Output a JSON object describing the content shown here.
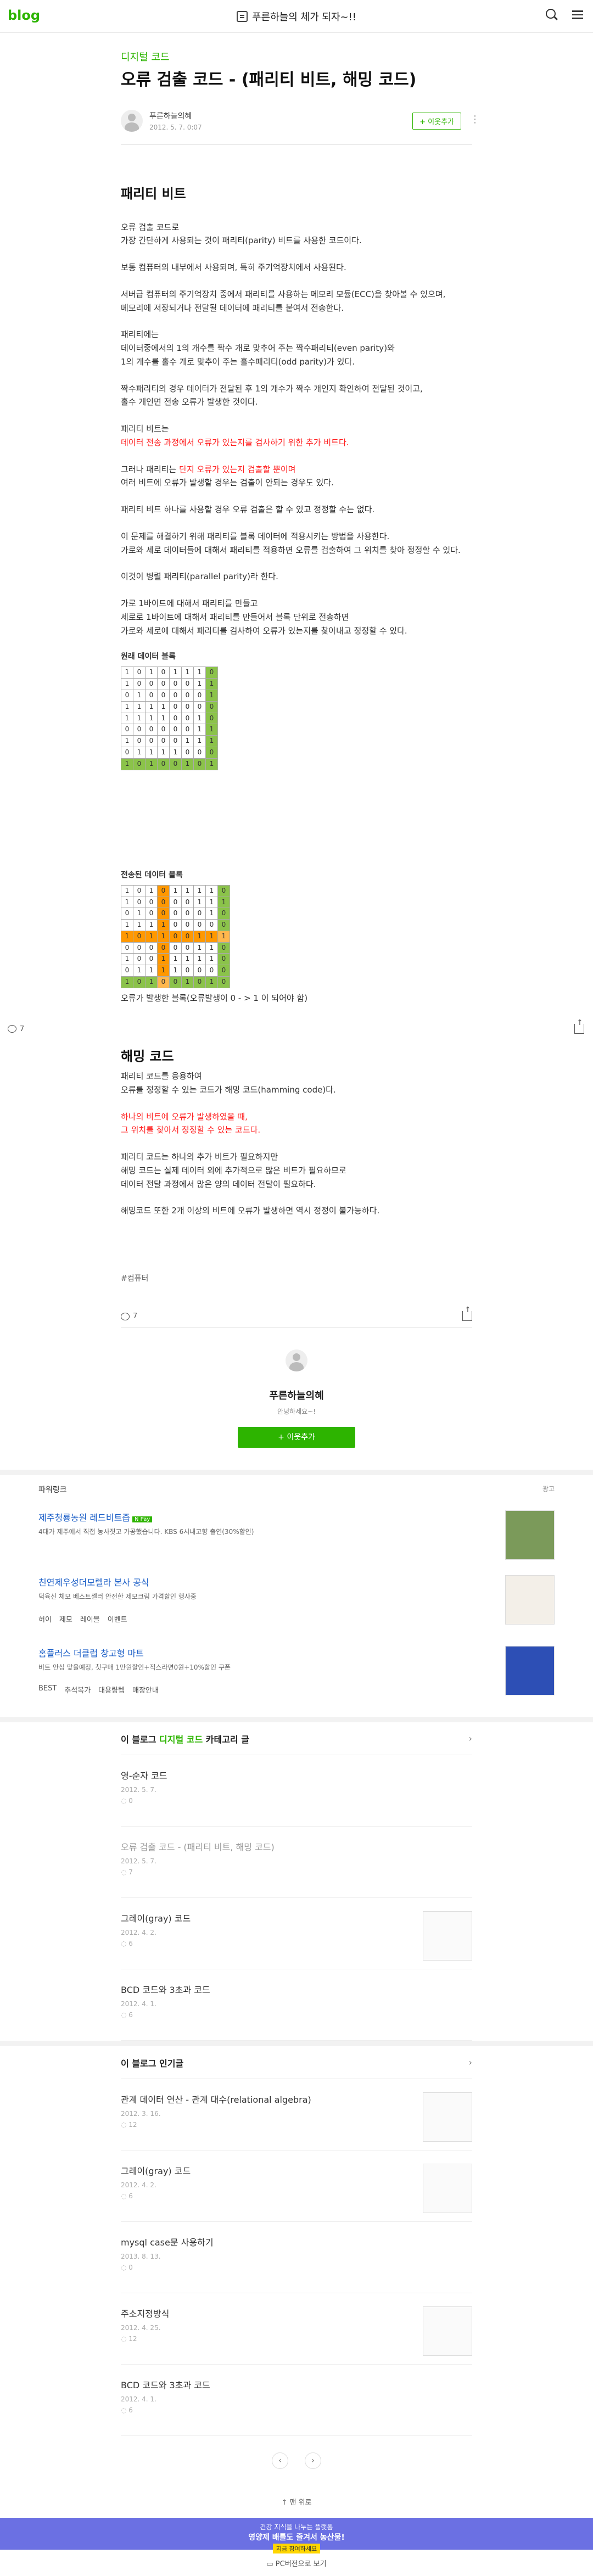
{
  "header": {
    "logo": "blog",
    "blog_title": "푸른하늘의 체가 되자~!!"
  },
  "post": {
    "category": "디지털 코드",
    "title": "오류 검출 코드 - (패리티 비트, 해밍 코드)",
    "author": "푸른하늘의혜",
    "date": "2012. 5. 7. 0:07",
    "follow_label": "+ 이웃추가",
    "section1_title": "패리티 비트",
    "p1": "오류 검출 코드로\n가장 간단하게 사용되는 것이 패리티(parity) 비트를 사용한 코드이다.",
    "p2": "보통 컴퓨터의 내부에서 사용되며, 특히 주기억장치에서 사용된다.",
    "p3": "서버급 컴퓨터의 주기억장치 중에서 패리티를 사용하는 메모리 모듈(ECC)을 찾아볼 수 있으며,\n메모리에 저장되거나 전달될 데이터에 패리티를 붙여서 전송한다.",
    "p4": " 패리티에는\n데이터중에서의 1의 개수를 짝수 개로 맞추어 주는 짝수패리티(even parity)와\n1의 개수를 홀수 개로 맞추어 주는 홀수패리티(odd parity)가 있다.",
    "p5": "짝수패리티의 경우 데이터가 전달된 후 1의 개수가 짝수 개인지 확인하여 전달된 것이고,\n홀수 개인면 전송 오류가 발생한 것이다.",
    "p6a": "패리티 비트는",
    "p6b": "데이터 전송 과정에서 오류가 있는지를 검사하기 위한 추가 비트다.",
    "p7a": "그러나 패리티는 ",
    "p7b": "단지 오류가 있는지 검출할 뿐이며",
    "p7c": "여러 비트에 오류가 발생할 경우는 검출이 안되는 경우도 있다.",
    "p8": "패리티 비트 하나를 사용할 경우 오류 검출은 할 수 있고 정정할 수는 없다.",
    "p9": "이 문제를 해결하기 위해 패리티를 블록 데이터에 적용시키는 방법을 사용한다.\n가로와 세로 데이터들에 대해서 패리티를 적용하면 오류를 검출하여 그 위치를 찾아 정정할 수 있다.",
    "p10": "이것이 병렬 패리티(parallel parity)라 한다.",
    "p11": "가로 1바이트에 대해서 패리티를 만들고\n세로로 1바이트에 대해서 패리티를 만들어서 블록 단위로 전송하면\n가로와 세로에 대해서 패리티를 검사하여 오류가 있는지를 찾아내고 정정할 수 있다.",
    "table1_label": "원래 데이터 블록",
    "table1": [
      [
        "1",
        "0",
        "1",
        "0",
        "1",
        "1",
        "1",
        "0"
      ],
      [
        "1",
        "0",
        "0",
        "0",
        "0",
        "0",
        "1",
        "1"
      ],
      [
        "0",
        "1",
        "0",
        "0",
        "0",
        "0",
        "0",
        "1"
      ],
      [
        "1",
        "1",
        "1",
        "1",
        "0",
        "0",
        "0",
        "0"
      ],
      [
        "1",
        "1",
        "1",
        "1",
        "0",
        "0",
        "1",
        "0"
      ],
      [
        "0",
        "0",
        "0",
        "0",
        "0",
        "0",
        "1",
        "1"
      ],
      [
        "1",
        "0",
        "0",
        "0",
        "0",
        "1",
        "1",
        "1"
      ],
      [
        "0",
        "1",
        "1",
        "1",
        "1",
        "0",
        "0",
        "0"
      ],
      [
        "1",
        "0",
        "1",
        "0",
        "0",
        "1",
        "0",
        "1"
      ]
    ],
    "table2_label": "전송된 데이터 블록",
    "table2": [
      [
        "1",
        "0",
        "1",
        "0",
        "1",
        "1",
        "1",
        "1",
        "0"
      ],
      [
        "1",
        "0",
        "0",
        "0",
        "0",
        "0",
        "1",
        "1",
        "1"
      ],
      [
        "0",
        "1",
        "0",
        "0",
        "0",
        "0",
        "0",
        "1",
        "0"
      ],
      [
        "1",
        "1",
        "1",
        "1",
        "0",
        "0",
        "0",
        "0",
        "0"
      ],
      [
        "1",
        "0",
        "1",
        "1",
        "0",
        "0",
        "1",
        "1",
        "1"
      ],
      [
        "0",
        "0",
        "0",
        "0",
        "0",
        "0",
        "1",
        "1",
        "0"
      ],
      [
        "1",
        "0",
        "0",
        "1",
        "1",
        "1",
        "1",
        "1",
        "0"
      ],
      [
        "0",
        "1",
        "1",
        "1",
        "1",
        "0",
        "0",
        "0",
        "0"
      ],
      [
        "1",
        "0",
        "1",
        "0",
        "0",
        "1",
        "0",
        "1",
        "0"
      ]
    ],
    "table_caption": "오류가 발생한 블록(오류발생이 0 - > 1 이 되어야 함)",
    "comment_count": "7",
    "section2_title": "해밍 코드",
    "h1": "패리티 코드를 응용하여\n오류를 정정할 수 있는 코드가 해밍 코드(hamming code)다.",
    "h2": "하나의 비트에 오류가 발생하였을 때,\n그 위치를 찾아서 정정할 수 있는 코드다.",
    "h3": "패리티 코드는 하나의 추가 비트가 필요하지만\n해밍 코드는 실제 데이터 외에 추가적으로 많은 비트가 필요하므로\n데이터 전달 과정에서 많은 양의 데이터 전달이 필요하다.",
    "h4": "해밍코드 또한 2개 이상의 비트에 오류가 발생하면 역시 정정이 불가능하다.",
    "tag": "#컴퓨터"
  },
  "profile": {
    "name": "푸른하늘의혜",
    "desc": "안녕하세요~!",
    "follow": "+ 이웃추가"
  },
  "ads": {
    "label": "파워링크",
    "ad_label": "광고",
    "items": [
      {
        "title": "제주청룡농원 레드비트즙",
        "badge": "N Pay",
        "sub": "4대가 제주에서 직접 농사짓고 가공했습니다. KBS 6시내고향 출연(30%할인)"
      },
      {
        "title": "친연제우성더모렐라 본사 공식",
        "sub": "덕육신 체모 베스트셀러 안전한 제모크림 가격할인 행사중"
      },
      {
        "title": "홈플러스 더클럽 창고형 마트",
        "sub": "비트 안심 맞을예정, 첫구매 1만원할인+적스라면0원+10%할인 쿠폰"
      }
    ],
    "links1": [
      "허이",
      "제모",
      "레이블",
      "이벤트"
    ],
    "links2": [
      "BEST",
      "추석복가",
      "대용량템",
      "매장안내"
    ]
  },
  "category_list": {
    "title_a": "이 블로그 ",
    "title_b": "디지털 코드",
    "title_c": " 카테고리 글",
    "items": [
      {
        "title": "영-순자 코드",
        "date": "2012. 5. 7.",
        "cmt": "0"
      },
      {
        "title": "오류 검출 코드 - (패리티 비트, 해밍 코드)",
        "date": "2012. 5. 7.",
        "cmt": "7"
      },
      {
        "title": "그레이(gray) 코드",
        "date": "2012. 4. 2.",
        "cmt": "6"
      },
      {
        "title": "BCD 코드와 3초과 코드",
        "date": "2012. 4. 1.",
        "cmt": "6"
      }
    ]
  },
  "popular_list": {
    "title": "이 블로그 인기글",
    "items": [
      {
        "title": "관계 데이터 연산 - 관계 대수(relational algebra)",
        "date": "2012. 3. 16.",
        "cmt": "12"
      },
      {
        "title": "그레이(gray) 코드",
        "date": "2012. 4. 2.",
        "cmt": "6"
      },
      {
        "title": "mysql case문 사용하기",
        "date": "2013. 8. 13.",
        "cmt": "0"
      },
      {
        "title": "주소지정방식",
        "date": "2012. 4. 25.",
        "cmt": "12"
      },
      {
        "title": "BCD 코드와 3초과 코드",
        "date": "2012. 4. 1.",
        "cmt": "6"
      }
    ]
  },
  "footer": {
    "totop": "맨 위로",
    "banner1": "건강 지식을 나누는 플랫폼",
    "banner2": "영양제 배틀도 즐겨서 농산물!",
    "banner3": "지금 참여하세요",
    "pcview": "PC버전으로 보기"
  }
}
